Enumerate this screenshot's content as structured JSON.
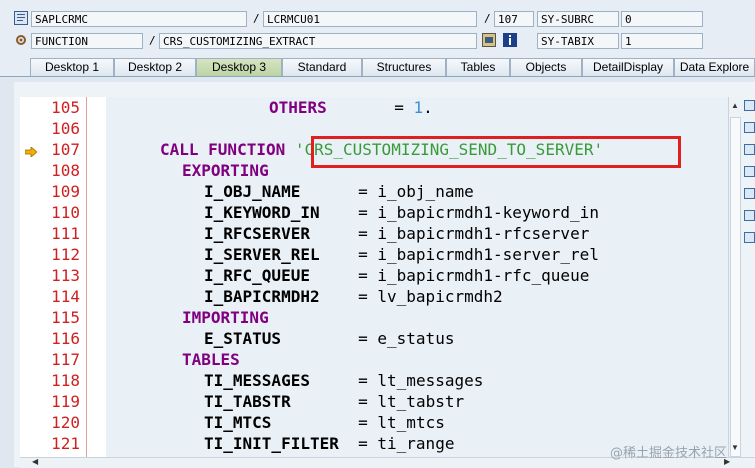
{
  "header": {
    "row1": {
      "program": "SAPLCRMC",
      "include": "LCRMCU01",
      "line": "107",
      "sysfield": "SY-SUBRC",
      "sysvalue": "0"
    },
    "row2": {
      "type": "FUNCTION",
      "name": "CRS_CUSTOMIZING_EXTRACT",
      "sysfield": "SY-TABIX",
      "sysvalue": "1"
    },
    "slash": "/"
  },
  "tabs": [
    {
      "label": "Desktop 1",
      "active": false
    },
    {
      "label": "Desktop 2",
      "active": false
    },
    {
      "label": "Desktop 3",
      "active": true
    },
    {
      "label": "Standard",
      "active": false
    },
    {
      "label": "Structures",
      "active": false
    },
    {
      "label": "Tables",
      "active": false
    },
    {
      "label": "Objects",
      "active": false
    },
    {
      "label": "DetailDisplay",
      "active": false
    },
    {
      "label": "Data Explore",
      "active": false
    }
  ],
  "code": {
    "current_line": "107",
    "lines": [
      {
        "num": "105",
        "text": "OTHERS       = 1."
      },
      {
        "num": "106",
        "text": ""
      },
      {
        "num": "107",
        "text": "CALL FUNCTION 'CRS_CUSTOMIZING_SEND_TO_SERVER'"
      },
      {
        "num": "108",
        "text": "EXPORTING"
      },
      {
        "num": "109",
        "text": "I_OBJ_NAME      = i_obj_name"
      },
      {
        "num": "110",
        "text": "I_KEYWORD_IN    = i_bapicrmdh1-keyword_in"
      },
      {
        "num": "111",
        "text": "I_RFCSERVER     = i_bapicrmdh1-rfcserver"
      },
      {
        "num": "112",
        "text": "I_SERVER_REL    = i_bapicrmdh1-server_rel"
      },
      {
        "num": "113",
        "text": "I_RFC_QUEUE     = i_bapicrmdh1-rfc_queue"
      },
      {
        "num": "114",
        "text": "I_BAPICRMDH2    = lv_bapicrmdh2"
      },
      {
        "num": "115",
        "text": "IMPORTING"
      },
      {
        "num": "116",
        "text": "E_STATUS        = e_status"
      },
      {
        "num": "117",
        "text": "TABLES"
      },
      {
        "num": "118",
        "text": "TI_MESSAGES     = lt_messages"
      },
      {
        "num": "119",
        "text": "TI_TABSTR       = lt_tabstr"
      },
      {
        "num": "120",
        "text": "TI_MTCS         = lt_mtcs"
      },
      {
        "num": "121",
        "text": "TI_INIT_FILTER  = ti_range"
      }
    ]
  },
  "watermark": "@稀土掘金技术社区",
  "colors": {
    "keyword": "#800080",
    "string": "#3a9a3a",
    "number": "#3a8fd8",
    "line_number": "#d02020",
    "highlight_box": "#e02020",
    "active_tab": "#bcd4a4"
  },
  "icons": [
    "program-icon",
    "function-icon",
    "edit-icon",
    "info-icon",
    "current-line-arrow-icon"
  ]
}
